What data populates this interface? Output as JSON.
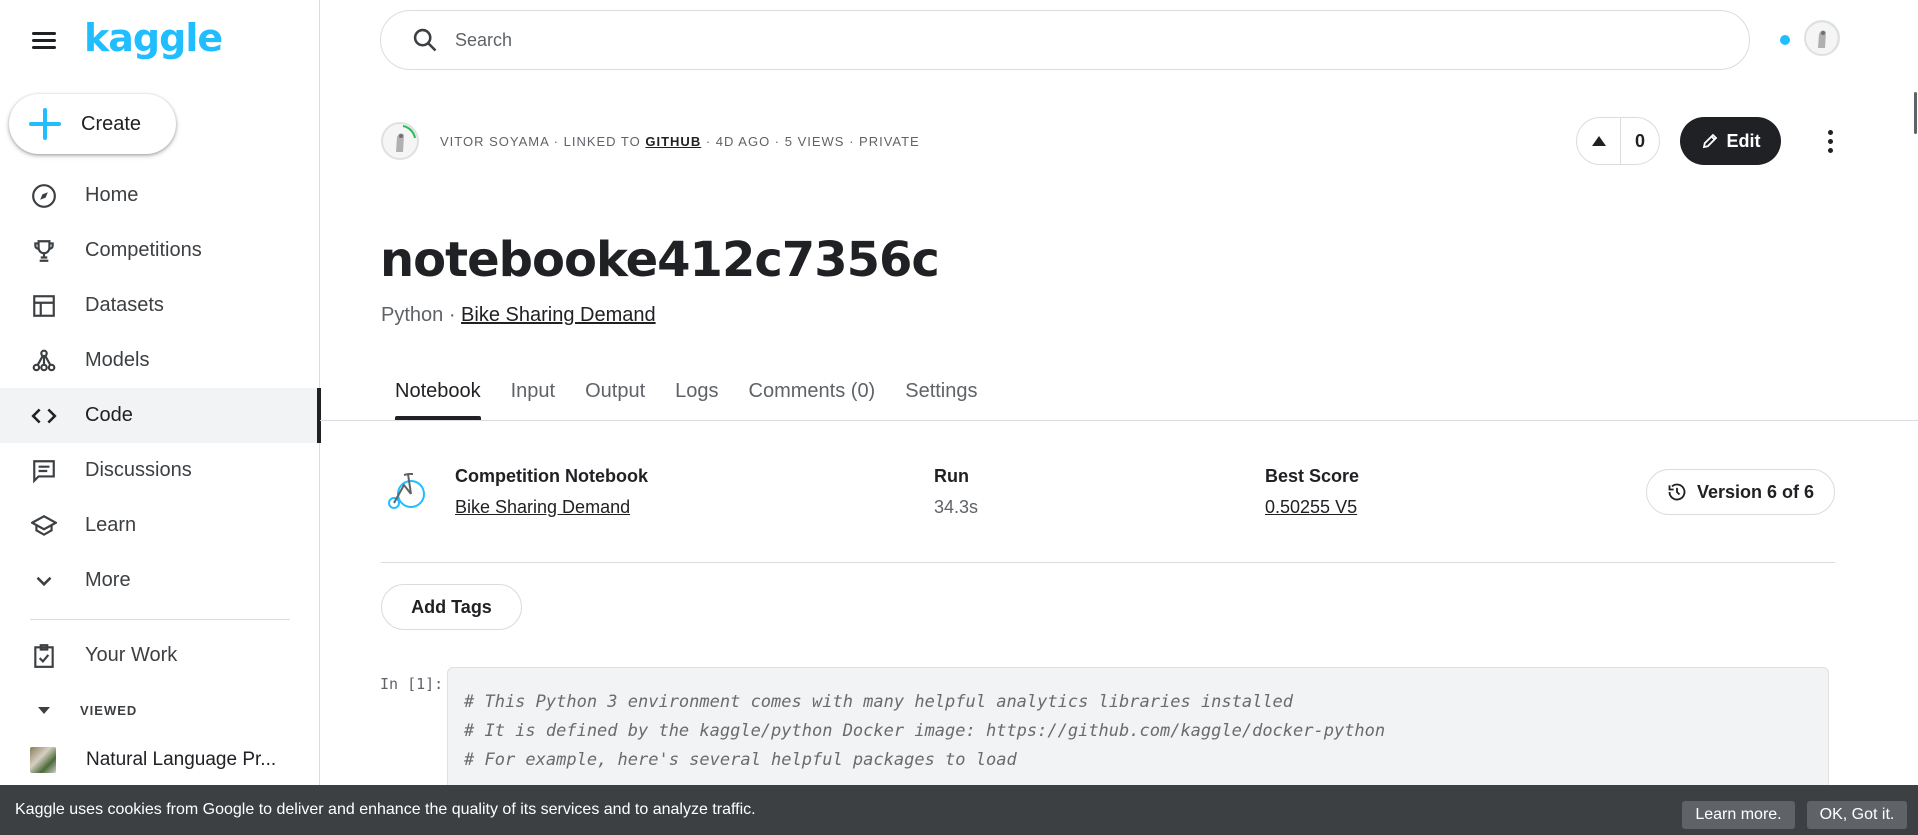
{
  "brand": {
    "logo_text": "kaggle",
    "accent": "#20beff"
  },
  "sidebar": {
    "create_label": "Create",
    "items": [
      {
        "label": "Home",
        "icon": "compass-icon"
      },
      {
        "label": "Competitions",
        "icon": "trophy-icon"
      },
      {
        "label": "Datasets",
        "icon": "table-icon"
      },
      {
        "label": "Models",
        "icon": "models-icon"
      },
      {
        "label": "Code",
        "icon": "code-icon",
        "active": true
      },
      {
        "label": "Discussions",
        "icon": "comments-icon"
      },
      {
        "label": "Learn",
        "icon": "school-icon"
      },
      {
        "label": "More",
        "icon": "chevron-down-icon"
      }
    ],
    "your_work": "Your Work",
    "viewed_label": "VIEWED",
    "recent": "Natural Language Pr..."
  },
  "search": {
    "placeholder": "Search"
  },
  "author": {
    "name": "VITOR SOYAMA",
    "linked_prefix": " · LINKED TO ",
    "linked": "GITHUB",
    "rest": " · 4D AGO · 5 VIEWS · PRIVATE"
  },
  "votes": {
    "count": "0"
  },
  "edit_label": "Edit",
  "notebook": {
    "title": "notebooke412c7356c",
    "language": "Python",
    "separator": " · ",
    "competition": "Bike Sharing Demand"
  },
  "tabs": [
    "Notebook",
    "Input",
    "Output",
    "Logs",
    "Comments (0)",
    "Settings"
  ],
  "info": {
    "type_title": "Competition Notebook",
    "type_value": "Bike Sharing Demand",
    "run_title": "Run",
    "run_value": "34.3s",
    "score_title": "Best Score",
    "score_value": "0.50255 V5",
    "version_label": "Version 6 of 6"
  },
  "add_tags": "Add Tags",
  "cell": {
    "prompt": "In [1]:",
    "lines": [
      "# This Python 3 environment comes with many helpful analytics libraries installed",
      "# It is defined by the kaggle/python Docker image: https://github.com/kaggle/docker-python",
      "# For example, here's several helpful packages to load"
    ]
  },
  "cookie": {
    "text": "Kaggle uses cookies from Google to deliver and enhance the quality of its services and to analyze traffic.",
    "learn_more": "Learn more.",
    "ok": "OK, Got it."
  }
}
